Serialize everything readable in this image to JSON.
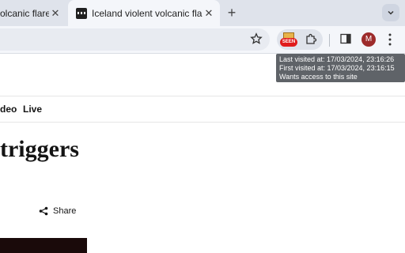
{
  "tabs": [
    {
      "title": "olcanic flare-",
      "close": "✕"
    },
    {
      "title": "Iceland violent volcanic flare-",
      "close": "✕"
    }
  ],
  "new_tab": "+",
  "extension": {
    "badge": "SEEN"
  },
  "profile": {
    "initial": "M"
  },
  "tooltip": {
    "last_visited": "Last visited at: 17/03/2024, 23:16:26",
    "first_visited": "First visited at: 17/03/2024, 23:16:15",
    "access": "Wants access to this site"
  },
  "page": {
    "nav": [
      "deo",
      "Live"
    ],
    "headline": "triggers",
    "share_label": "Share"
  }
}
